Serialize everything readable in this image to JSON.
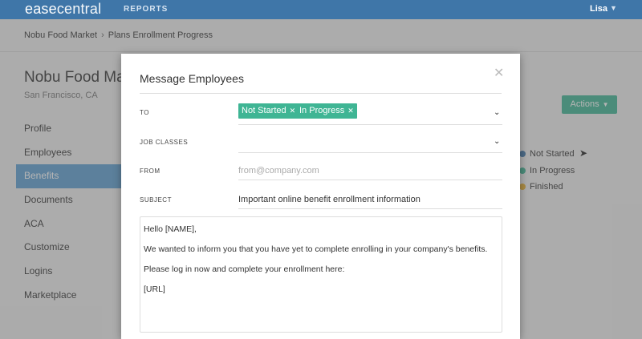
{
  "nav": {
    "logo_a": "ease",
    "logo_b": "central",
    "reports": "REPORTS",
    "user": "Lisa"
  },
  "breadcrumb": {
    "company": "Nobu Food Market",
    "page": "Plans Enrollment Progress"
  },
  "company": {
    "name": "Nobu Food Market",
    "location": "San Francisco, CA"
  },
  "sidebar": {
    "items": [
      {
        "label": "Profile"
      },
      {
        "label": "Employees"
      },
      {
        "label": "Benefits"
      },
      {
        "label": "Documents"
      },
      {
        "label": "ACA"
      },
      {
        "label": "Customize"
      },
      {
        "label": "Logins"
      },
      {
        "label": "Marketplace"
      }
    ]
  },
  "actions": {
    "label": "Actions"
  },
  "legend": [
    {
      "label": "Not Started",
      "color": "#3f76a8"
    },
    {
      "label": "In Progress",
      "color": "#3fb594"
    },
    {
      "label": "Finished",
      "color": "#e8b030"
    }
  ],
  "modal": {
    "title": "Message Employees",
    "to_label": "TO",
    "to_tags": [
      "Not Started",
      "In Progress"
    ],
    "job_classes_label": "JOB CLASSES",
    "from_label": "FROM",
    "from_placeholder": "from@company.com",
    "subject_label": "SUBJECT",
    "subject_value": "Important online benefit enrollment information",
    "message": [
      "Hello [NAME],",
      "We wanted to inform you that you have yet to complete enrolling in your company's benefits.",
      "Please log in now and complete your enrollment here:",
      "[URL]"
    ]
  },
  "colors": {
    "nav": "#3f76a8",
    "accent": "#3fb594",
    "active": "#5d9fd1"
  }
}
